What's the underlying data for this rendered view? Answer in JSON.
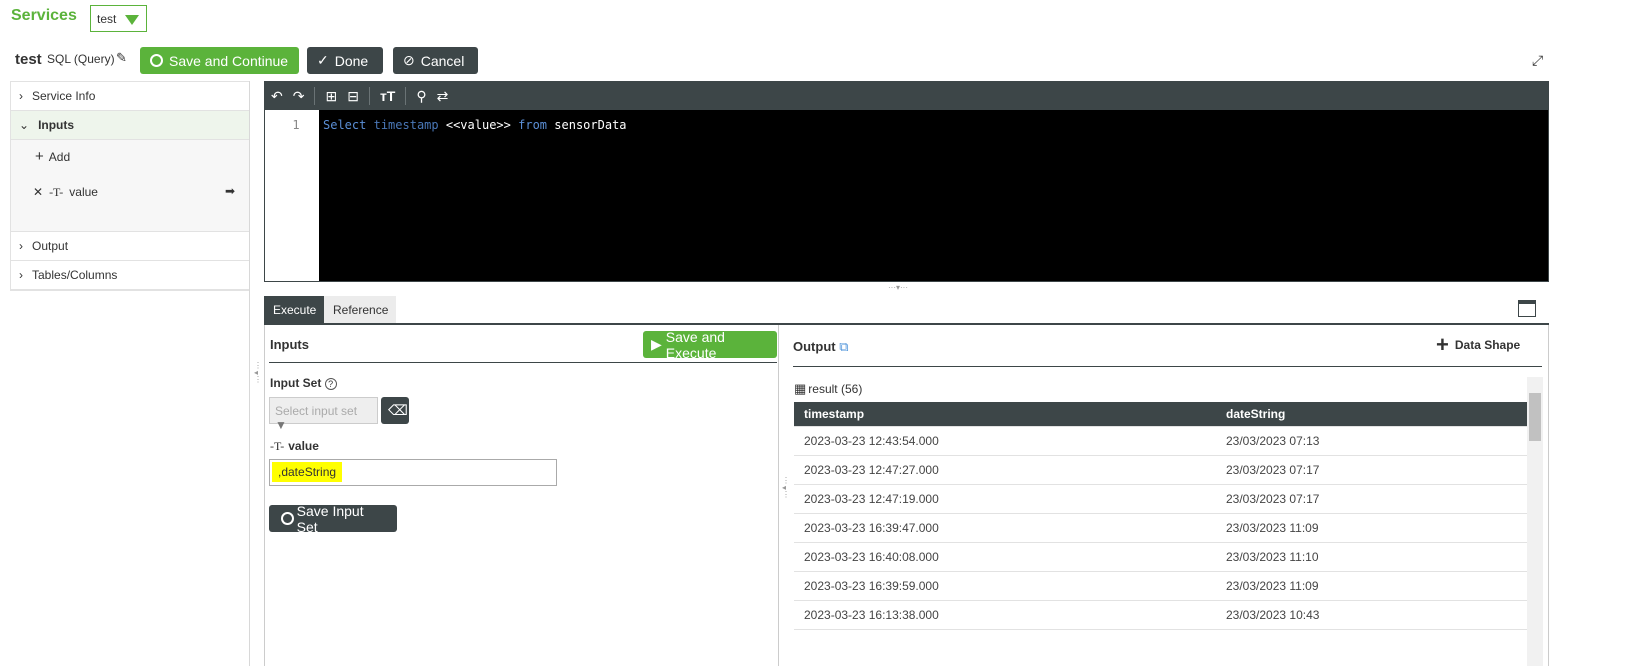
{
  "header": {
    "section": "Services",
    "service_select": "test",
    "service_name": "test",
    "service_type": "SQL (Query)"
  },
  "toolbar": {
    "save_continue": "Save and Continue",
    "done": "Done",
    "cancel": "Cancel"
  },
  "sidebar": {
    "service_info": "Service Info",
    "inputs": "Inputs",
    "add": "Add",
    "input_name": "value",
    "output": "Output",
    "tables": "Tables/Columns"
  },
  "editor": {
    "line": "1",
    "kw_select": "Select",
    "col": "timestamp",
    "param": "<<value>>",
    "kw_from": "from",
    "table": "sensorData"
  },
  "tabs": {
    "execute": "Execute",
    "reference": "Reference"
  },
  "inputs": {
    "title": "Inputs",
    "save_execute": "Save and Execute",
    "input_set_label": "Input Set",
    "input_set_placeholder": "Select input set",
    "value_label": "value",
    "value": ",dateString",
    "save_input_set": "Save Input Set"
  },
  "output": {
    "title": "Output",
    "data_shape": "Data Shape",
    "result": "result (56)",
    "columns": [
      "timestamp",
      "dateString"
    ],
    "rows": [
      [
        "2023-03-23 12:43:54.000",
        "23/03/2023 07:13"
      ],
      [
        "2023-03-23 12:47:27.000",
        "23/03/2023 07:17"
      ],
      [
        "2023-03-23 12:47:19.000",
        "23/03/2023 07:17"
      ],
      [
        "2023-03-23 16:39:47.000",
        "23/03/2023 11:09"
      ],
      [
        "2023-03-23 16:40:08.000",
        "23/03/2023 11:10"
      ],
      [
        "2023-03-23 16:39:59.000",
        "23/03/2023 11:09"
      ],
      [
        "2023-03-23 16:13:38.000",
        "23/03/2023 10:43"
      ]
    ]
  }
}
